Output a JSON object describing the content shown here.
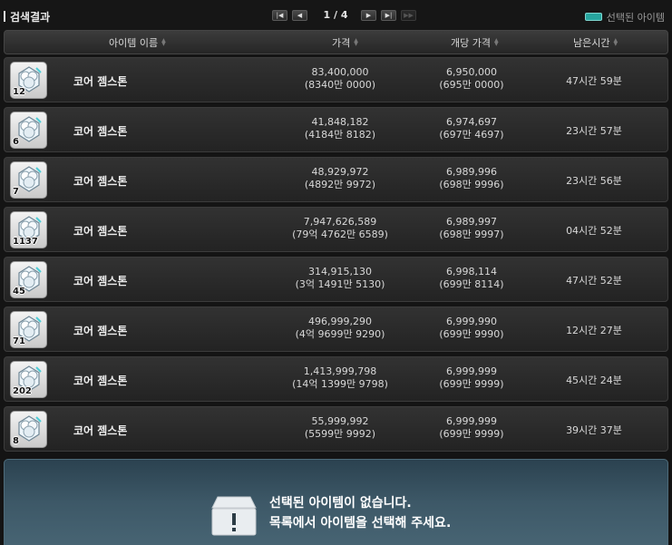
{
  "header": {
    "title": "검색결과",
    "page_info": "1 / 4",
    "legend_label": "선택된 아이템",
    "legend_color": "#27a59f",
    "pager_buttons": [
      "first-page",
      "prev-page",
      "next-page",
      "last-page",
      "skip-forward"
    ]
  },
  "columns": {
    "name": "아이템 이름",
    "price": "가격",
    "unit_price": "개당 가격",
    "time_left": "남은시간"
  },
  "items": [
    {
      "icon": "gemstone-icon",
      "qty": "12",
      "name": "코어 젬스톤",
      "price": "83,400,000",
      "price_kr": "(8340만 0000)",
      "unit_price": "6,950,000",
      "unit_price_kr": "(695만 0000)",
      "time_left": "47시간 59분"
    },
    {
      "icon": "gemstone-icon",
      "qty": "6",
      "name": "코어 젬스톤",
      "price": "41,848,182",
      "price_kr": "(4184만 8182)",
      "unit_price": "6,974,697",
      "unit_price_kr": "(697만 4697)",
      "time_left": "23시간 57분"
    },
    {
      "icon": "gemstone-icon",
      "qty": "7",
      "name": "코어 젬스톤",
      "price": "48,929,972",
      "price_kr": "(4892만 9972)",
      "unit_price": "6,989,996",
      "unit_price_kr": "(698만 9996)",
      "time_left": "23시간 56분"
    },
    {
      "icon": "gemstone-icon",
      "qty": "1137",
      "name": "코어 젬스톤",
      "price": "7,947,626,589",
      "price_kr": "(79억 4762만 6589)",
      "unit_price": "6,989,997",
      "unit_price_kr": "(698만 9997)",
      "time_left": "04시간 52분"
    },
    {
      "icon": "gemstone-icon",
      "qty": "45",
      "name": "코어 젬스톤",
      "price": "314,915,130",
      "price_kr": "(3억 1491만 5130)",
      "unit_price": "6,998,114",
      "unit_price_kr": "(699만 8114)",
      "time_left": "47시간 52분"
    },
    {
      "icon": "gemstone-icon",
      "qty": "71",
      "name": "코어 젬스톤",
      "price": "496,999,290",
      "price_kr": "(4억 9699만 9290)",
      "unit_price": "6,999,990",
      "unit_price_kr": "(699만 9990)",
      "time_left": "12시간 27분"
    },
    {
      "icon": "gemstone-icon",
      "qty": "202",
      "name": "코어 젬스톤",
      "price": "1,413,999,798",
      "price_kr": "(14억 1399만 9798)",
      "unit_price": "6,999,999",
      "unit_price_kr": "(699만 9999)",
      "time_left": "45시간 24분"
    },
    {
      "icon": "gemstone-icon",
      "qty": "8",
      "name": "코어 젬스톤",
      "price": "55,999,992",
      "price_kr": "(5599만 9992)",
      "unit_price": "6,999,999",
      "unit_price_kr": "(699만 9999)",
      "time_left": "39시간 37분"
    }
  ],
  "detail": {
    "icon": "empty-box-warning-icon",
    "line1": "선택된 아이템이 없습니다.",
    "line2": "목록에서 아이템을 선택해 주세요."
  }
}
